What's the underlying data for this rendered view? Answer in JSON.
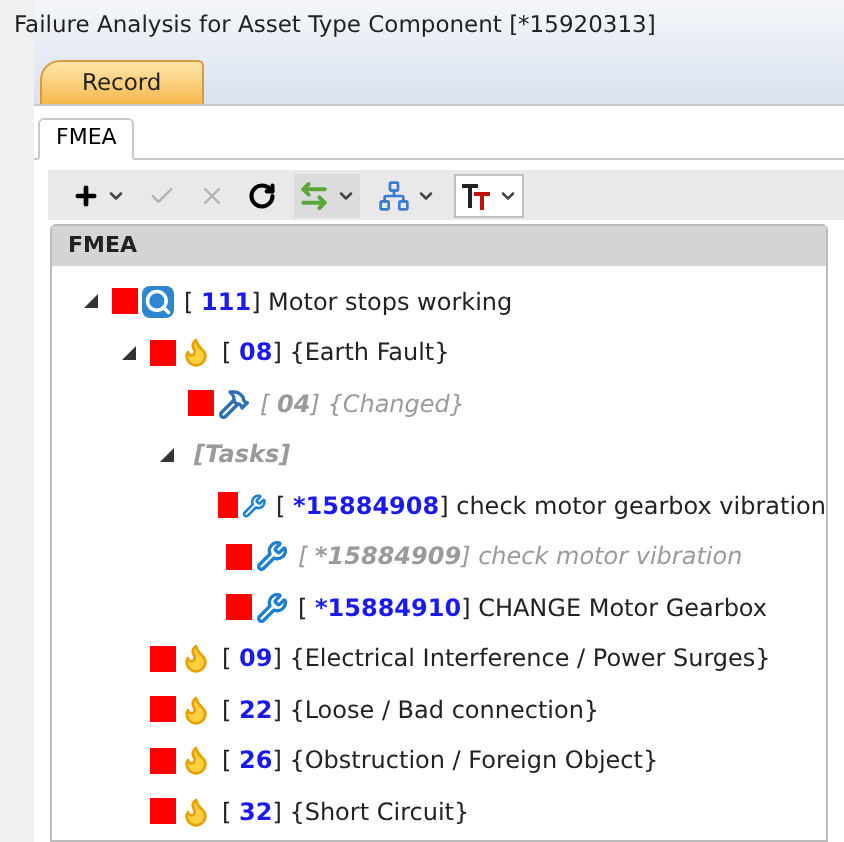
{
  "window": {
    "title": "Failure Analysis for Asset Type Component [*15920313]"
  },
  "tabs": [
    {
      "label": "Record",
      "selected": true
    }
  ],
  "subtabs": [
    {
      "label": "FMEA",
      "selected": true
    }
  ],
  "toolbar": [
    {
      "kind": "add",
      "disabled": false,
      "menu": true
    },
    {
      "kind": "accept",
      "disabled": true,
      "menu": false
    },
    {
      "kind": "cancel",
      "disabled": true,
      "menu": false
    },
    {
      "kind": "refresh",
      "disabled": false,
      "menu": false
    },
    {
      "kind": "swap",
      "disabled": false,
      "menu": true
    },
    {
      "kind": "hierarchy",
      "disabled": false,
      "menu": true
    },
    {
      "kind": "font",
      "disabled": false,
      "menu": true
    }
  ],
  "tree": {
    "header": "FMEA",
    "nodes": [
      {
        "kind": "failure",
        "label": "[ **111**] Motor stops working",
        "color": "#ff0000",
        "disabled": false,
        "expanded": true,
        "children": [
          {
            "kind": "cause",
            "label": "[ **08**] {Earth Fault}",
            "color": "#ff0000",
            "disabled": false,
            "expanded": true,
            "children": [
              {
                "kind": "remedy",
                "label": "[ **04**] {Changed}",
                "color": "#ff0000",
                "disabled": true
              },
              {
                "kind": "group",
                "label": "[Tasks]",
                "disabled": true,
                "expanded": true,
                "children": [
                  {
                    "kind": "task",
                    "label": "[ ***15884908**] check motor gearbox vibration",
                    "color": "#ff0000",
                    "disabled": false
                  },
                  {
                    "kind": "task",
                    "label": "[ ***15884909**] check motor vibration",
                    "color": "#ff0000",
                    "disabled": true
                  },
                  {
                    "kind": "task",
                    "label": "[ ***15884910**] CHANGE Motor Gearbox",
                    "color": "#ff0000",
                    "disabled": false
                  }
                ]
              }
            ]
          },
          {
            "kind": "cause",
            "label": "[ **09**] {Electrical Interference / Power Surges}",
            "color": "#ff0000",
            "disabled": false
          },
          {
            "kind": "cause",
            "label": "[ **22**] {Loose / Bad connection}",
            "color": "#ff0000",
            "disabled": false
          },
          {
            "kind": "cause",
            "label": "[ **26**] {Obstruction / Foreign Object}",
            "color": "#ff0000",
            "disabled": false
          },
          {
            "kind": "cause",
            "label": "[ **32**] {Short Circuit}",
            "color": "#ff0000",
            "disabled": false
          }
        ]
      }
    ]
  }
}
